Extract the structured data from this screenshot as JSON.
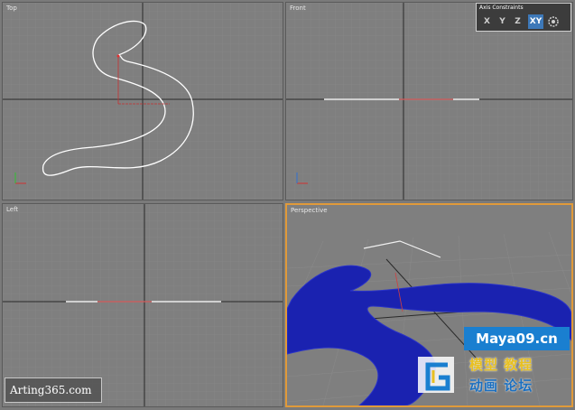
{
  "viewports": {
    "top": {
      "label": "Top"
    },
    "front": {
      "label": "Front"
    },
    "left": {
      "label": "Left"
    },
    "perspective": {
      "label": "Perspective"
    }
  },
  "axis_constraints": {
    "title": "Axis Constraints",
    "buttons": [
      "X",
      "Y",
      "Z",
      "XY"
    ],
    "active": "XY",
    "extra_icon": "gear-icon"
  },
  "watermarks": {
    "arting": "Arting365.com",
    "maya": "Maya09.cn",
    "cn_line1": "模型 教程",
    "cn_line2": "动画 论坛"
  },
  "colors": {
    "grid_bg": "#7f7f7f",
    "spline": "#ffffff",
    "mesh": "#1a22b0",
    "active_border": "#e09a3a",
    "axis_red": "#c83030"
  }
}
